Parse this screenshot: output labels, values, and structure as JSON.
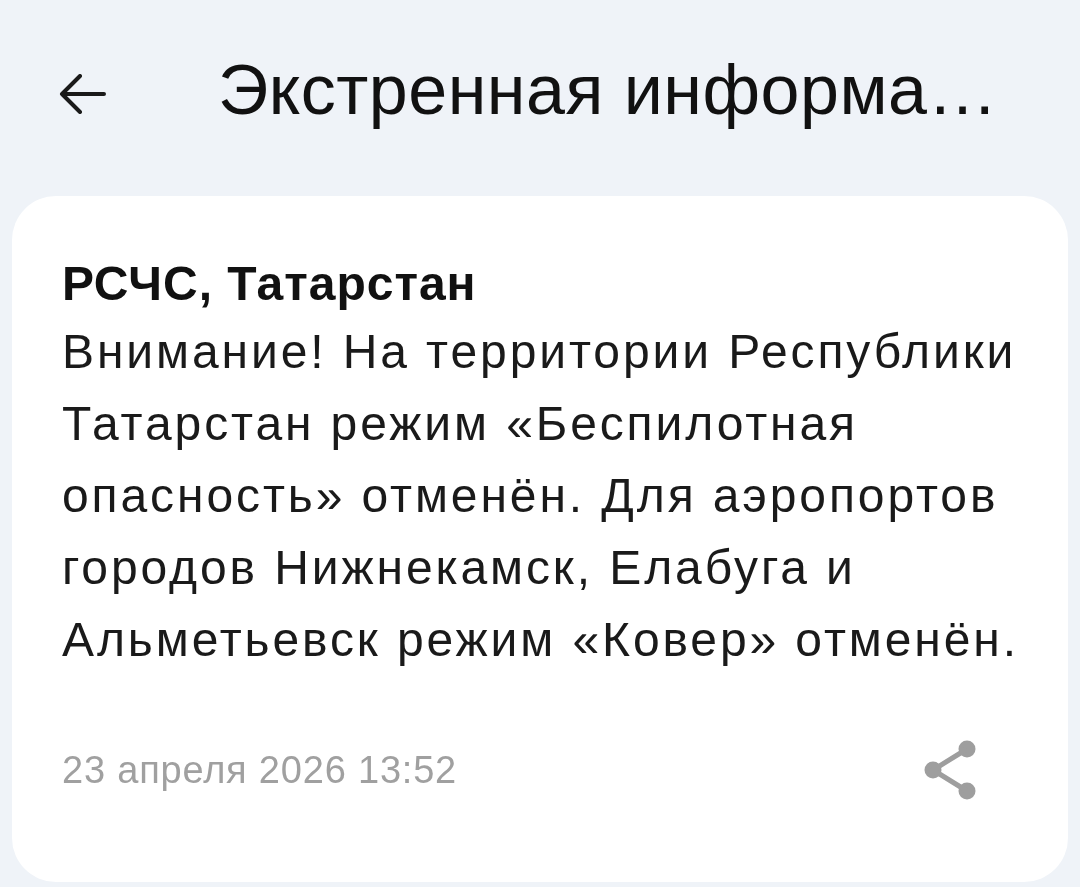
{
  "header": {
    "title": "Экстренная информа…"
  },
  "alert": {
    "source": "РСЧС, Татарстан",
    "message": "Внимание! На территории Республики Татарстан режим «Беспилотная опасность» отменён. Для аэропортов городов Нижнекамск, Елабуга и Альметьевск режим «Ковер» отменён.",
    "timestamp": "23 апреля 2026 13:52"
  }
}
